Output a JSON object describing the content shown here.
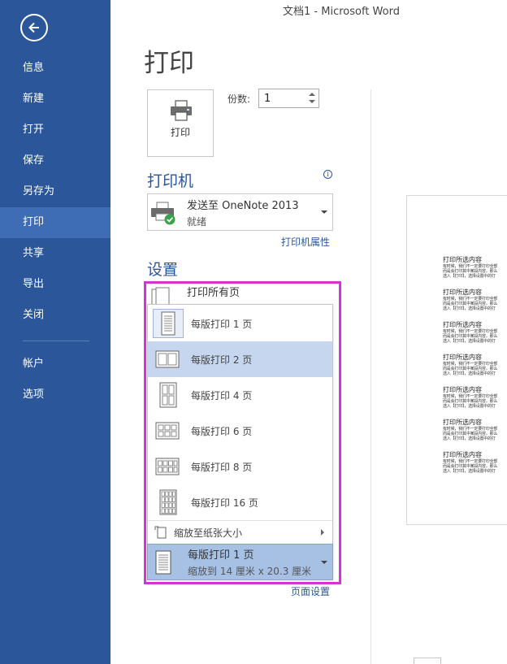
{
  "window": {
    "title": "文档1 - Microsoft Word"
  },
  "sidebar": {
    "items": [
      {
        "label": "信息"
      },
      {
        "label": "新建"
      },
      {
        "label": "打开"
      },
      {
        "label": "保存"
      },
      {
        "label": "另存为"
      },
      {
        "label": "打印",
        "active": true
      },
      {
        "label": "共享"
      },
      {
        "label": "导出"
      },
      {
        "label": "关闭"
      },
      {
        "label": "帐户"
      },
      {
        "label": "选项"
      }
    ],
    "color": "#2b579a",
    "active_color": "#3e6db5"
  },
  "main": {
    "title": "打印",
    "print_button": {
      "label": "打印",
      "icon": "printer-icon"
    },
    "copies": {
      "label": "份数:",
      "value": "1"
    },
    "printer": {
      "section_title": "打印机",
      "name": "发送至 OneNote 2013",
      "status": "就绪",
      "properties_link": "打印机属性",
      "icon": "printer-check-icon"
    },
    "settings": {
      "section_title": "设置",
      "print_range": {
        "title": "打印所有页"
      },
      "pages_menu": {
        "items": [
          {
            "label": "每版打印 1 页",
            "icon": "one-page-icon"
          },
          {
            "label": "每版打印 2 页",
            "icon": "two-pages-icon",
            "highlighted": true
          },
          {
            "label": "每版打印 4 页",
            "icon": "four-pages-icon"
          },
          {
            "label": "每版打印 6 页",
            "icon": "six-pages-icon"
          },
          {
            "label": "每版打印 8 页",
            "icon": "eight-pages-icon"
          },
          {
            "label": "每版打印 16 页",
            "icon": "sixteen-pages-icon"
          }
        ],
        "scale_item": "缩放至纸张大小"
      },
      "pages_per_sheet": {
        "title": "每版打印 1 页",
        "subtitle": "缩放到 14 厘米 x 20.3 厘米"
      },
      "page_setup_link": "页面设置"
    },
    "highlight_color": "#d633d6"
  },
  "preview": {
    "blocks": [
      {
        "heading": "打印所选内容",
        "lines": [
          "有时候，我们不一定要打印全部",
          "而是会打印其中某段内容，那么",
          "选入【打印】，选择设置中的打"
        ]
      },
      {
        "heading": "打印所选内容",
        "lines": [
          "有时候，我们不一定要打印全部",
          "而是会打印其中某段内容，那么",
          "选入【打印】，选择设置中的打"
        ]
      },
      {
        "heading": "打印所选内容",
        "lines": [
          "有时候，我们不一定要打印全部",
          "而是会打印其中某段内容，那么",
          "选入【打印】，选择设置中的打"
        ]
      },
      {
        "heading": "打印所选内容",
        "lines": [
          "有时候，我们不一定要打印全部",
          "而是会打印其中某段内容，那么",
          "选入【打印】，选择设置中的打"
        ]
      },
      {
        "heading": "打印所选内容",
        "lines": [
          "有时候，我们不一定要打印全部",
          "而是会打印其中某段内容，那么",
          "选入【打印】，选择设置中的打"
        ]
      },
      {
        "heading": "打印所选内容",
        "lines": [
          "有时候，我们不一定要打印全部",
          "而是会打印其中某段内容，那么",
          "选入【打印】，选择设置中的打"
        ]
      },
      {
        "heading": "打印所选内容",
        "lines": [
          "有时候，我们不一定要打印全部",
          "而是会打印其中某段内容，那么",
          "选入【打印】，选择设置中的打"
        ]
      }
    ]
  }
}
